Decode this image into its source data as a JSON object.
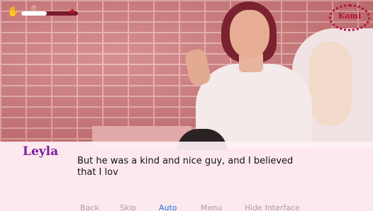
{
  "hud": {
    "progress_fraction": 0.45,
    "icons": [
      "hand-icon",
      "location-pin-icon",
      "dragon-icon"
    ]
  },
  "logo": {
    "text": "Kami"
  },
  "dialogue": {
    "speaker": "Leyla",
    "text": "But he was a kind and nice guy, and I believed that I lov",
    "speaker_color": "#7b1fa2"
  },
  "quick_menu": {
    "items": [
      {
        "label": "Back",
        "active": false
      },
      {
        "label": "Skip",
        "active": false
      },
      {
        "label": "Auto",
        "active": true
      },
      {
        "label": "Menu",
        "active": false
      },
      {
        "label": "Hide Interface",
        "active": false
      }
    ],
    "active_color": "#1f6fdc",
    "inactive_color": "#aa9aa8"
  }
}
